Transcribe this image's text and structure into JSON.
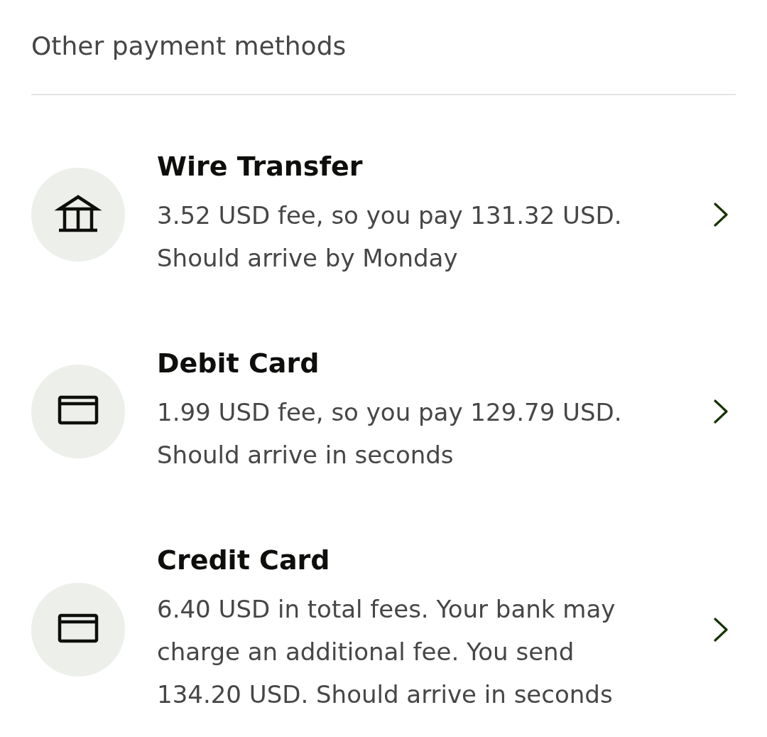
{
  "heading": "Other payment methods",
  "methods": [
    {
      "kind": "bank",
      "title": "Wire Transfer",
      "description": "3.52 USD fee, so you pay 131.32 USD. Should arrive by Monday"
    },
    {
      "kind": "card",
      "title": "Debit Card",
      "description": "1.99 USD fee, so you pay 129.79 USD. Should arrive in seconds"
    },
    {
      "kind": "card",
      "title": "Credit Card",
      "description": "6.40 USD in total fees. Your bank may charge an additional fee. You send 134.20 USD. Should arrive in seconds"
    }
  ]
}
